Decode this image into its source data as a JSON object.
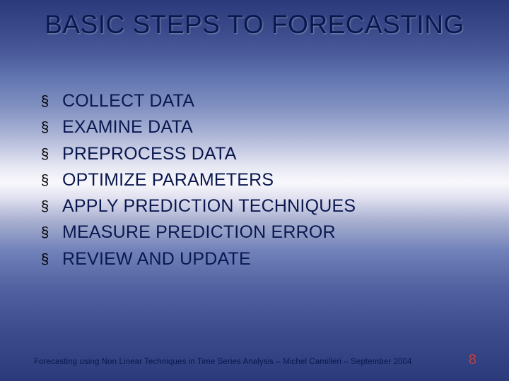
{
  "title": "BASIC STEPS TO FORECASTING",
  "bullets": [
    "COLLECT DATA",
    "EXAMINE DATA",
    "PREPROCESS DATA",
    "OPTIMIZE PARAMETERS",
    "APPLY PREDICTION TECHNIQUES",
    "MEASURE PREDICTION ERROR",
    "REVIEW AND UPDATE"
  ],
  "footer": "Forecasting using Non Linear Techniques in Time Series Analysis – Michel Camilleri – September 2004",
  "page": "8",
  "bullet_glyph": "§"
}
